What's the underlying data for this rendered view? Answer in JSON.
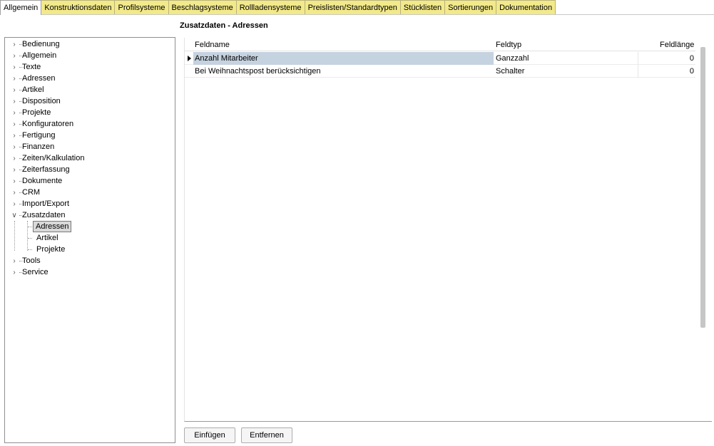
{
  "tabs": [
    {
      "label": "Allgemein",
      "active": true
    },
    {
      "label": "Konstruktionsdaten"
    },
    {
      "label": "Profilsysteme"
    },
    {
      "label": "Beschlagsysteme"
    },
    {
      "label": "Rollladensysteme"
    },
    {
      "label": "Preislisten/Standardtypen"
    },
    {
      "label": "Stücklisten"
    },
    {
      "label": "Sortierungen"
    },
    {
      "label": "Dokumentation"
    }
  ],
  "tree": {
    "items": [
      {
        "label": "Bedienung"
      },
      {
        "label": "Allgemein"
      },
      {
        "label": "Texte"
      },
      {
        "label": "Adressen"
      },
      {
        "label": "Artikel"
      },
      {
        "label": "Disposition"
      },
      {
        "label": "Projekte"
      },
      {
        "label": "Konfiguratoren"
      },
      {
        "label": "Fertigung"
      },
      {
        "label": "Finanzen"
      },
      {
        "label": "Zeiten/Kalkulation"
      },
      {
        "label": "Zeiterfassung"
      },
      {
        "label": "Dokumente"
      },
      {
        "label": "CRM"
      },
      {
        "label": "Import/Export"
      },
      {
        "label": "Zusatzdaten",
        "expanded": true,
        "children": [
          {
            "label": "Adressen",
            "selected": true
          },
          {
            "label": "Artikel"
          },
          {
            "label": "Projekte"
          }
        ]
      },
      {
        "label": "Tools"
      },
      {
        "label": "Service"
      }
    ]
  },
  "main": {
    "title": "Zusatzdaten - Adressen",
    "columns": [
      "Feldname",
      "Feldtyp",
      "Feldlänge"
    ],
    "rows": [
      {
        "feldname": "Anzahl Mitarbeiter",
        "feldtyp": "Ganzzahl",
        "feldlaenge": "0",
        "current": true
      },
      {
        "feldname": "Bei Weihnachtspost berücksichtigen",
        "feldtyp": "Schalter",
        "feldlaenge": "0"
      }
    ]
  },
  "buttons": {
    "insert": "Einfügen",
    "remove": "Entfernen"
  },
  "colors": {
    "tab_bg": "#f2e98a",
    "row_highlight": "#c5d2df"
  }
}
